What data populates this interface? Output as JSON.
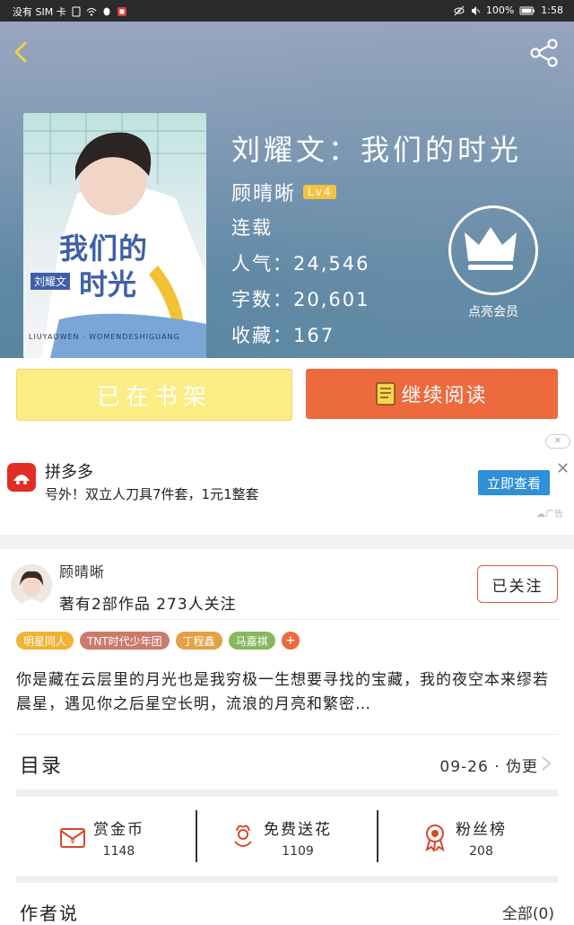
{
  "status_bar": {
    "carrier": "没有 SIM 卡",
    "battery": "100%",
    "time": "1:58"
  },
  "book": {
    "title": "刘耀文：我们的时光",
    "author": "顾晴晰",
    "level": "Lv4",
    "status": "连载",
    "popularity_label": "人气：",
    "popularity": "24,546",
    "words_label": "字数：",
    "words": "20,601",
    "favorites_label": "收藏：",
    "favorites": "167",
    "cover": {
      "title_line1": "我们的",
      "title_line2": "时光",
      "tag": "刘耀文",
      "pinyin": "LIUYAOWEN · WOMENDESHIGUANG"
    }
  },
  "vip": {
    "label": "点亮会员"
  },
  "actions": {
    "shelf": "已在书架",
    "read": "继续阅读"
  },
  "ad": {
    "brand": "拼多多",
    "text": "号外！双立人刀具7件套，1元1整套",
    "cta": "立即查看",
    "tag": "广告"
  },
  "author_card": {
    "name": "顾晴晰",
    "meta": "著有2部作品 273人关注",
    "follow": "已关注"
  },
  "tags": [
    {
      "label": "明星同人",
      "color": "#f2b233"
    },
    {
      "label": "TNT时代少年团",
      "color": "#cc7a6c"
    },
    {
      "label": "丁程鑫",
      "color": "#e2a143"
    },
    {
      "label": "马嘉祺",
      "color": "#86b85d"
    }
  ],
  "description": "你是藏在云层里的月光也是我穷极一生想要寻找的宝藏，我的夜空本来缪若晨星，遇见你之后星空长明，流浪的月亮和繁密…",
  "toc": {
    "title": "目录",
    "update": "09-26 · 伪更"
  },
  "stats": [
    {
      "label": "赏金币",
      "value": "1148",
      "icon": "coin-envelope-icon"
    },
    {
      "label": "免费送花",
      "value": "1109",
      "icon": "flower-icon"
    },
    {
      "label": "粉丝榜",
      "value": "208",
      "icon": "medal-icon"
    }
  ],
  "author_says": {
    "title": "作者说",
    "count": "全部(0)"
  }
}
